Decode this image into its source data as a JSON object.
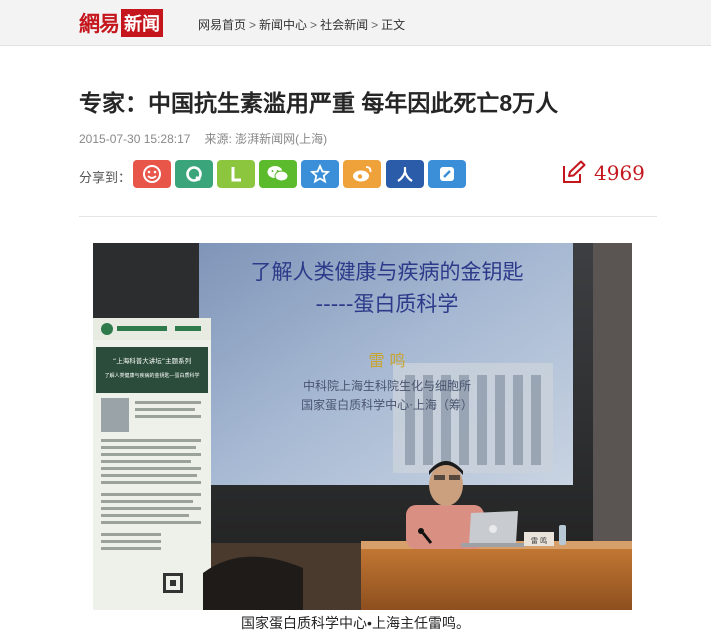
{
  "site": {
    "logo_part1": "網易",
    "logo_part2": "新闻"
  },
  "breadcrumb": [
    {
      "label": "网易首页"
    },
    {
      "label": "新闻中心"
    },
    {
      "label": "社会新闻"
    },
    {
      "label": "正文"
    }
  ],
  "breadcrumb_sep": ">",
  "article": {
    "title": "专家：中国抗生素滥用严重 每年因此死亡8万人",
    "datetime": "2015-07-30 15:28:17",
    "source": "来源: 澎湃新闻网(上海)"
  },
  "share": {
    "label": "分享到：",
    "buttons": [
      {
        "name": "share-icon-1",
        "color": "#e8564a",
        "glyph": "☺"
      },
      {
        "name": "share-icon-2",
        "color": "#3aa57a",
        "glyph": "Q"
      },
      {
        "name": "share-icon-3",
        "color": "#8cc63f",
        "glyph": "L"
      },
      {
        "name": "wechat",
        "color": "#5cbb2d",
        "glyph": "wx"
      },
      {
        "name": "favorite",
        "color": "#3a8fd8",
        "glyph": "☆"
      },
      {
        "name": "weibo",
        "color": "#f0a23a",
        "glyph": "wb"
      },
      {
        "name": "renren",
        "color": "#2a5caa",
        "glyph": "人"
      },
      {
        "name": "share-icon-8",
        "color": "#3a8fd8",
        "glyph": "◪"
      }
    ]
  },
  "comments": {
    "count": "4969"
  },
  "photo": {
    "slide_title_line1": "了解人类健康与疾病的金钥匙",
    "slide_title_line2": "-----蛋白质科学",
    "slide_name": "雷 鸣",
    "slide_org_line1": "中科院上海生科院生化与细胞所",
    "slide_org_line2": "国家蛋白质科学中心·上海（筹）",
    "banner_title": "“上海科普大讲坛”主题系列",
    "banner_subtitle": "了解人类健康与疾病的金钥匙—蛋白质科学",
    "nameplate": "雷 鸣"
  },
  "caption": "国家蛋白质科学中心•上海主任雷鸣。",
  "colors": {
    "brand_red": "#c4161c"
  }
}
